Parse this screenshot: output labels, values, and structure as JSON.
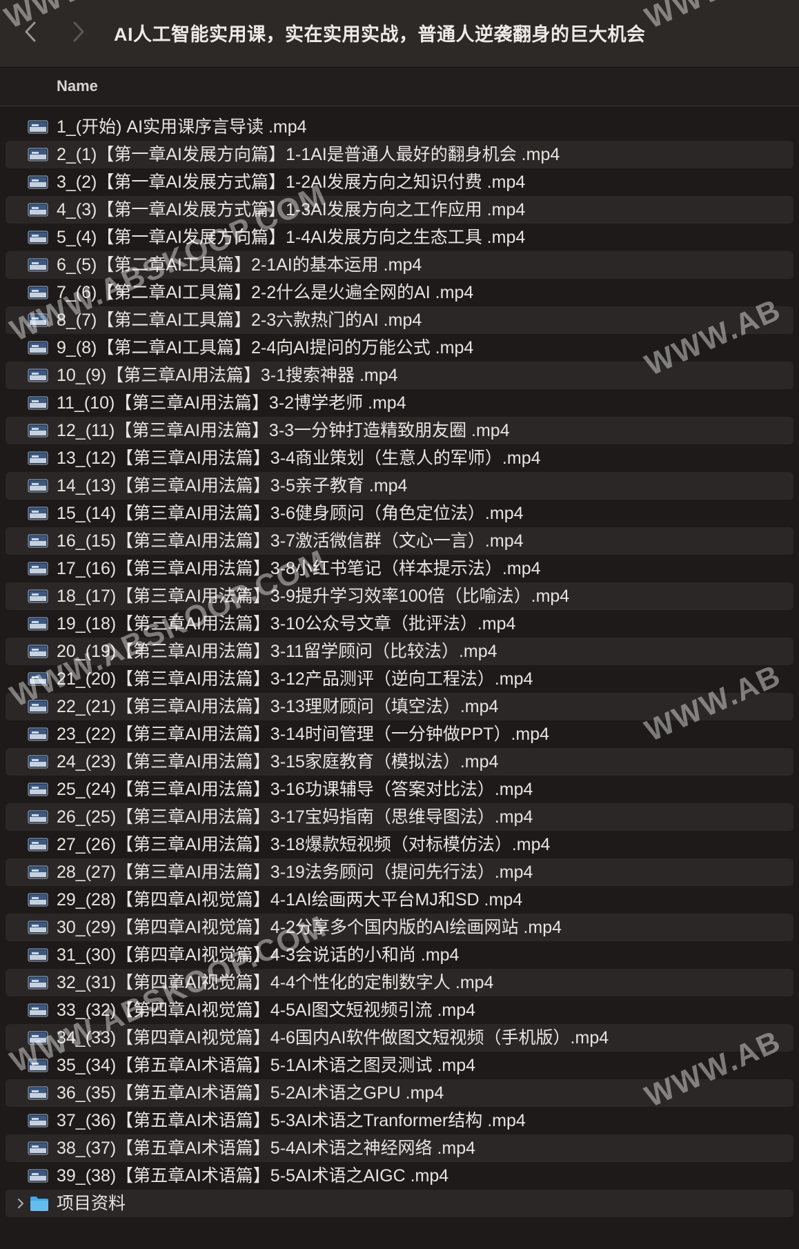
{
  "window": {
    "title": "AI人工智能实用课，实在实用实战，普通人逆袭翻身的巨大机会"
  },
  "header": {
    "column_name": "Name"
  },
  "files": [
    "1_(开始) AI实用课序言导读  .mp4",
    "2_(1)【第一章AI发展方向篇】1-1AI是普通人最好的翻身机会  .mp4",
    "3_(2)【第一章AI发展方式篇】1-2AI发展方向之知识付费  .mp4",
    "4_(3)【第一章AI发展方式篇】1-3AI发展方向之工作应用  .mp4",
    "5_(4)【第一章AI发展方向篇】1-4AI发展方向之生态工具  .mp4",
    "6_(5)【第二章AI工具篇】2-1AI的基本运用  .mp4",
    "7_(6)【第二章AI工具篇】2-2什么是火遍全网的AI  .mp4",
    "8_(7)【第二章AI工具篇】2-3六款热门的AI  .mp4",
    "9_(8)【第二章AI工具篇】2-4向AI提问的万能公式  .mp4",
    "10_(9)【第三章AI用法篇】3-1搜索神器  .mp4",
    "11_(10)【第三章AI用法篇】3-2博学老师 .mp4",
    "12_(11)【第三章AI用法篇】3-3一分钟打造精致朋友圈 .mp4",
    "13_(12)【第三章AI用法篇】3-4商业策划（生意人的军师）.mp4",
    "14_(13)【第三章AI用法篇】3-5亲子教育 .mp4",
    "15_(14)【第三章AI用法篇】3-6健身顾问（角色定位法）.mp4",
    "16_(15)【第三章AI用法篇】3-7激活微信群（文心一言）.mp4",
    "17_(16)【第三章AI用法篇】3-8小红书笔记（样本提示法）.mp4",
    "18_(17)【第三章AI用法篇】3-9提升学习效率100倍（比喻法）.mp4",
    "19_(18)【第三章AI用法篇】3-10公众号文章（批评法）.mp4",
    "20_(19)【第三章AI用法篇】3-11留学顾问（比较法）.mp4",
    "21_(20)【第三章AI用法篇】3-12产品测评（逆向工程法）.mp4",
    "22_(21)【第三章AI用法篇】3-13理财顾问（填空法）.mp4",
    "23_(22)【第三章AI用法篇】3-14时间管理（一分钟做PPT）.mp4",
    "24_(23)【第三章AI用法篇】3-15家庭教育（模拟法）.mp4",
    "25_(24)【第三章AI用法篇】3-16功课辅导（答案对比法）.mp4",
    "26_(25)【第三章AI用法篇】3-17宝妈指南（思维导图法）.mp4",
    "27_(26)【第三章AI用法篇】3-18爆款短视频（对标模仿法）.mp4",
    "28_(27)【第三章AI用法篇】3-19法务顾问（提问先行法）.mp4",
    "29_(28)【第四章AI视觉篇】4-1AI绘画两大平台MJ和SD .mp4",
    "30_(29)【第四章AI视觉篇】4-2分享多个国内版的AI绘画网站 .mp4",
    "31_(30)【第四章AI视觉篇】4-3会说话的小和尚 .mp4",
    "32_(31)【第四章AI视觉篇】4-4个性化的定制数字人 .mp4",
    "33_(32)【第四章AI视觉篇】4-5AI图文短视频引流 .mp4",
    "34_(33)【第四章AI视觉篇】4-6国内AI软件做图文短视频（手机版）.mp4",
    "35_(34)【第五章AI术语篇】5-1AI术语之图灵测试 .mp4",
    "36_(35)【第五章AI术语篇】5-2AI术语之GPU .mp4",
    "37_(36)【第五章AI术语篇】5-3AI术语之Tranformer结构 .mp4",
    "38_(37)【第五章AI术语篇】5-4AI术语之神经网络 .mp4",
    "39_(38)【第五章AI术语篇】5-5AI术语之AIGC .mp4"
  ],
  "folder": {
    "name": "项目资料"
  },
  "watermarks": {
    "left": "WWW.ABSKOOP.COM",
    "right": "WWW.ABS",
    "top_left": "WWW",
    "top_right": "WWW"
  },
  "icons": {
    "back": "chevron-left-icon",
    "forward": "chevron-right-icon",
    "file": "video-file-icon",
    "folder": "folder-icon",
    "disclosure": "chevron-right-icon"
  },
  "colors": {
    "background": "#1e1a19",
    "titlebar": "#2d2927",
    "row_alt": "#2b2726",
    "folder_blue": "#5ab4e8"
  }
}
